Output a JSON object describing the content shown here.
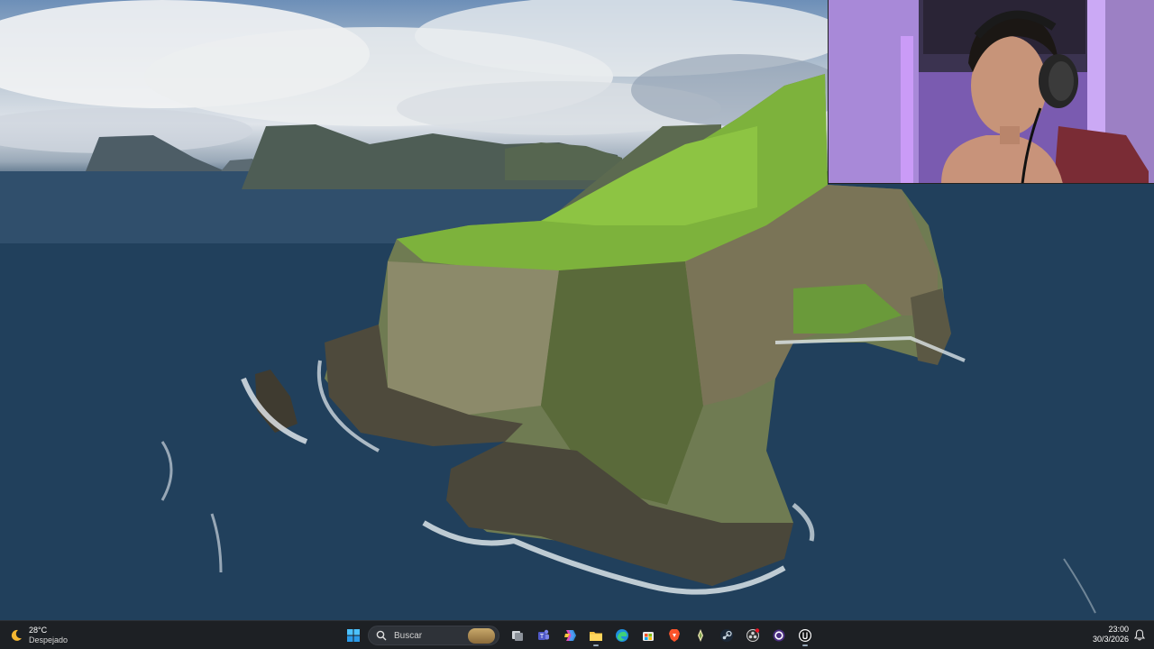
{
  "taskbar": {
    "weather": {
      "temperature": "28°C",
      "condition": "Despejado",
      "icon": "moon-icon"
    },
    "search": {
      "label": "Buscar",
      "icon": "search-icon"
    },
    "apps": [
      {
        "name": "start-button",
        "icon": "windows-logo-icon"
      },
      {
        "name": "task-view-button",
        "icon": "task-view-icon"
      },
      {
        "name": "teams-button",
        "icon": "teams-icon"
      },
      {
        "name": "copilot-button",
        "icon": "copilot-icon"
      },
      {
        "name": "file-explorer-button",
        "icon": "folder-icon"
      },
      {
        "name": "edge-button",
        "icon": "edge-icon"
      },
      {
        "name": "store-button",
        "icon": "store-icon"
      },
      {
        "name": "brave-button",
        "icon": "brave-icon"
      },
      {
        "name": "app-button",
        "icon": "pen-icon"
      },
      {
        "name": "steam-button",
        "icon": "steam-icon"
      },
      {
        "name": "obs-button",
        "icon": "record-icon"
      },
      {
        "name": "app-purple-button",
        "icon": "circle-icon"
      },
      {
        "name": "unreal-button",
        "icon": "unreal-icon"
      }
    ],
    "clock": {
      "time": "23:00",
      "date": "30/3/2026"
    },
    "notification_icon": "bell-icon"
  },
  "colors": {
    "taskbar_bg": "#1d2024",
    "webcam_light": "#a67be0",
    "sea": "#1f3d58",
    "grass": "#7bb33a"
  }
}
